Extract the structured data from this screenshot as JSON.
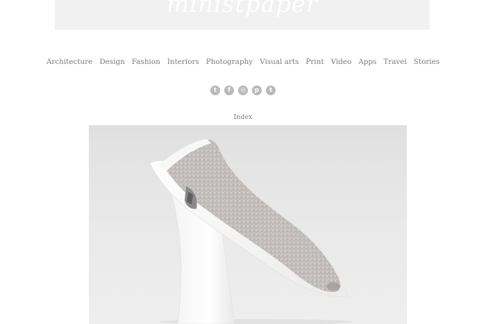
{
  "header": {
    "logo_text": "ministpaper"
  },
  "nav": {
    "items": [
      "Architecture",
      "Design",
      "Fashion",
      "Interiors",
      "Photography",
      "Visual arts",
      "Print",
      "Video",
      "Apps",
      "Travel",
      "Stories"
    ]
  },
  "social": {
    "icons": [
      {
        "name": "twitter-icon",
        "glyph": "t"
      },
      {
        "name": "facebook-icon",
        "glyph": "f"
      },
      {
        "name": "instagram-icon",
        "glyph": "◎"
      },
      {
        "name": "pinterest-icon",
        "glyph": "p"
      },
      {
        "name": "tumblr-icon",
        "glyph": "t"
      }
    ]
  },
  "index_label": "Index",
  "colors": {
    "header_band": "#f1f1f1",
    "nav_text": "#7a7a7a",
    "icon_bg": "#b9b9b9"
  }
}
